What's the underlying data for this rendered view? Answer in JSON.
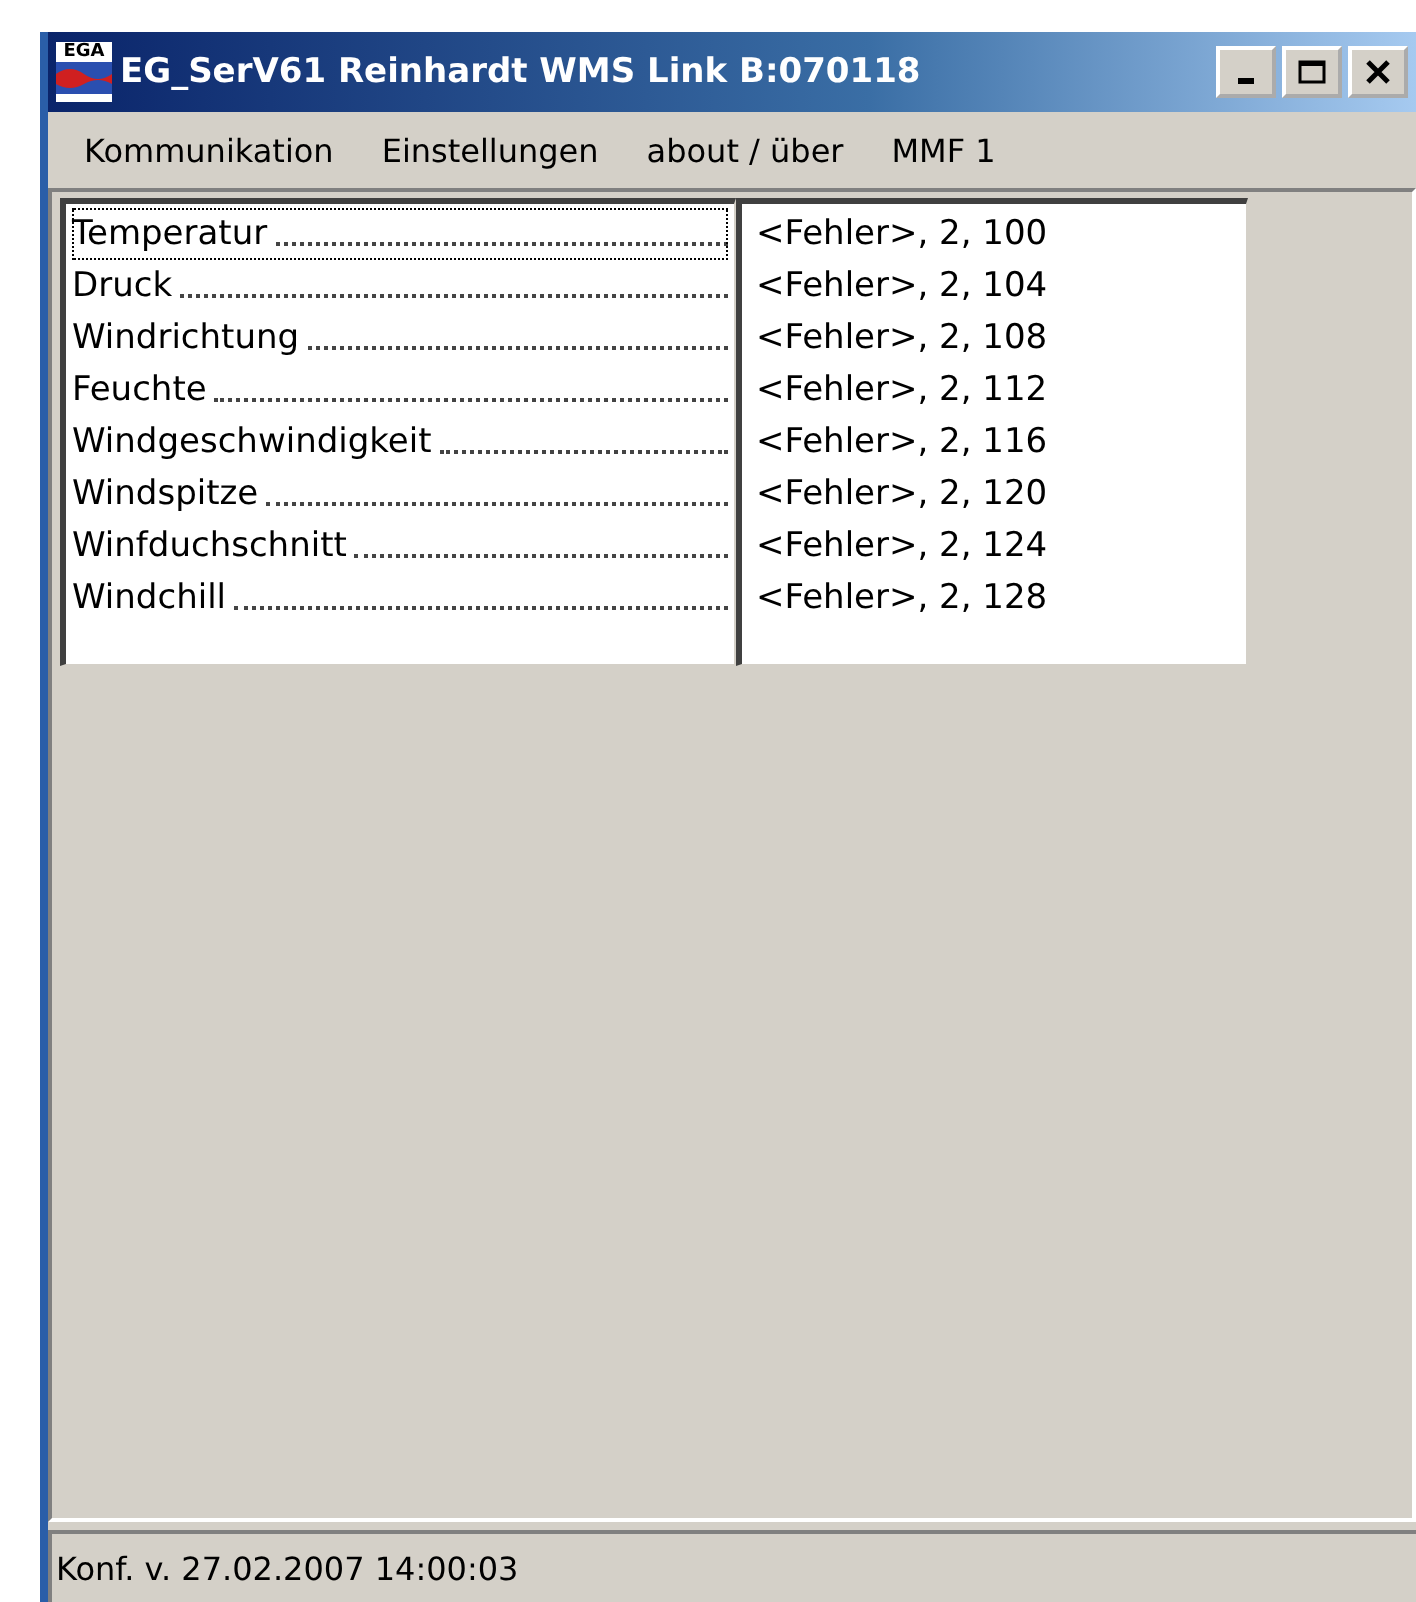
{
  "window": {
    "title": "EG_SerV61 Reinhardt WMS Link B:070118",
    "app_icon_text": "EGA"
  },
  "menu": [
    "Kommunikation",
    "Einstellungen",
    "about / über",
    "MMF 1"
  ],
  "channels": [
    {
      "name": "Temperatur",
      "value": "<Fehler>, 2, 100",
      "focused": true
    },
    {
      "name": "Druck",
      "value": "<Fehler>, 2, 104",
      "focused": false
    },
    {
      "name": "Windrichtung",
      "value": "<Fehler>, 2, 108",
      "focused": false
    },
    {
      "name": "Feuchte",
      "value": "<Fehler>, 2, 112",
      "focused": false
    },
    {
      "name": "Windgeschwindigkeit",
      "value": "<Fehler>, 2, 116",
      "focused": false
    },
    {
      "name": "Windspitze",
      "value": "<Fehler>, 2, 120",
      "focused": false
    },
    {
      "name": "Winfduchschnitt",
      "value": "<Fehler>, 2, 124",
      "focused": false
    },
    {
      "name": "Windchill",
      "value": "<Fehler>, 2, 128",
      "focused": false
    }
  ],
  "status_bar": "Konf. v. 27.02.2007 14:00:03"
}
